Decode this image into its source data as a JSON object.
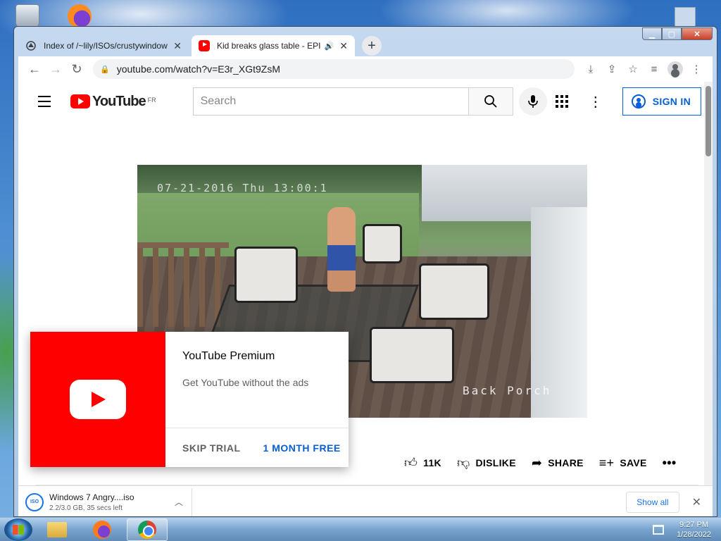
{
  "browser": {
    "tabs": [
      {
        "title": "Index of /~lily/ISOs/crustywindows",
        "active": false,
        "icon": "directory-icon"
      },
      {
        "title": "Kid breaks glass table - EPIC",
        "active": true,
        "icon": "youtube-favicon",
        "audio": true
      }
    ],
    "new_tab_symbol": "+",
    "url": "youtube.com/watch?v=E3r_XGt9ZsM",
    "window_controls": {
      "minimize": "▁",
      "maximize": "▢",
      "close": "✕"
    }
  },
  "youtube": {
    "logo_text": "YouTube",
    "country_code": "FR",
    "search_placeholder": "Search",
    "sign_in": "SIGN IN"
  },
  "video": {
    "timestamp_overlay": "07-21-2016 Thu 13:00:1",
    "camera_label": "Back Porch"
  },
  "actions": {
    "like_count": "11K",
    "dislike": "DISLIKE",
    "share": "SHARE",
    "save": "SAVE",
    "more": "•••"
  },
  "promo": {
    "title": "YouTube Premium",
    "description": "Get YouTube without the ads",
    "skip": "SKIP TRIAL",
    "cta": "1 MONTH FREE"
  },
  "download": {
    "filename": "Windows 7 Angry....iso",
    "status": "2.2/3.0 GB, 35 secs left",
    "icon_text": "ISO",
    "show_all": "Show all"
  },
  "taskbar": {
    "time": "9:27 PM",
    "date": "1/28/2022"
  },
  "colors": {
    "youtube_red": "#ff0000",
    "link_blue": "#065fd4",
    "chrome_blue": "#1a73e8"
  }
}
